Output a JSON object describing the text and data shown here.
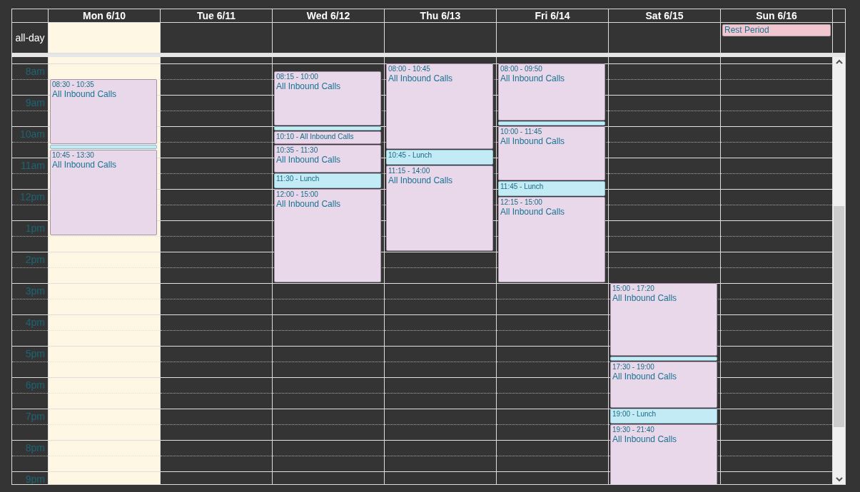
{
  "all_day_label": "all-day",
  "hours": [
    "8am",
    "9am",
    "10am",
    "11am",
    "12pm",
    "1pm",
    "2pm",
    "3pm",
    "4pm",
    "5pm",
    "6pm",
    "7pm",
    "8pm",
    "9pm"
  ],
  "days": [
    {
      "label": "Mon 6/10",
      "today": true,
      "events": [
        {
          "kind": "shift",
          "time": "08:30 - 10:35",
          "title": "All Inbound Calls"
        },
        {
          "kind": "break"
        },
        {
          "kind": "shift",
          "time": "10:45 - 13:30",
          "title": "All Inbound Calls"
        }
      ]
    },
    {
      "label": "Tue 6/11",
      "today": false
    },
    {
      "label": "Wed 6/12",
      "today": false,
      "events": [
        {
          "kind": "shift",
          "time": "08:15 - 10:00",
          "title": "All Inbound Calls"
        },
        {
          "kind": "break"
        },
        {
          "kind": "note",
          "label": "10:10 - All Inbound Calls"
        },
        {
          "kind": "shift",
          "time": "10:35 - 11:30",
          "title": "All Inbound Calls"
        },
        {
          "kind": "lunch",
          "label": "11:30 - Lunch"
        },
        {
          "kind": "shift",
          "time": "12:00 - 15:00",
          "title": "All Inbound Calls"
        }
      ]
    },
    {
      "label": "Thu 6/13",
      "today": false,
      "events": [
        {
          "kind": "shift",
          "time": "08:00 - 10:45",
          "title": "All Inbound Calls"
        },
        {
          "kind": "lunch",
          "label": "10:45 - Lunch"
        },
        {
          "kind": "shift",
          "time": "11:15 - 14:00",
          "title": "All Inbound Calls"
        }
      ]
    },
    {
      "label": "Fri 6/14",
      "today": false,
      "events": [
        {
          "kind": "shift",
          "time": "08:00 - 09:50",
          "title": "All Inbound Calls"
        },
        {
          "kind": "break"
        },
        {
          "kind": "shift",
          "time": "10:00 - 11:45",
          "title": "All Inbound Calls"
        },
        {
          "kind": "lunch",
          "label": "11:45 - Lunch"
        },
        {
          "kind": "shift",
          "time": "12:15 - 15:00",
          "title": "All Inbound Calls"
        }
      ]
    },
    {
      "label": "Sat 6/15",
      "today": false,
      "events": [
        {
          "kind": "shift",
          "time": "15:00 - 17:20",
          "title": "All Inbound Calls"
        },
        {
          "kind": "break"
        },
        {
          "kind": "shift",
          "time": "17:30 - 19:00",
          "title": "All Inbound Calls"
        },
        {
          "kind": "lunch",
          "label": "19:00 - Lunch"
        },
        {
          "kind": "shift",
          "time": "19:30 - 21:40",
          "title": "All Inbound Calls"
        }
      ]
    },
    {
      "label": "Sun 6/16",
      "today": false,
      "all_day": [
        {
          "title": "Rest Period"
        }
      ]
    }
  ]
}
